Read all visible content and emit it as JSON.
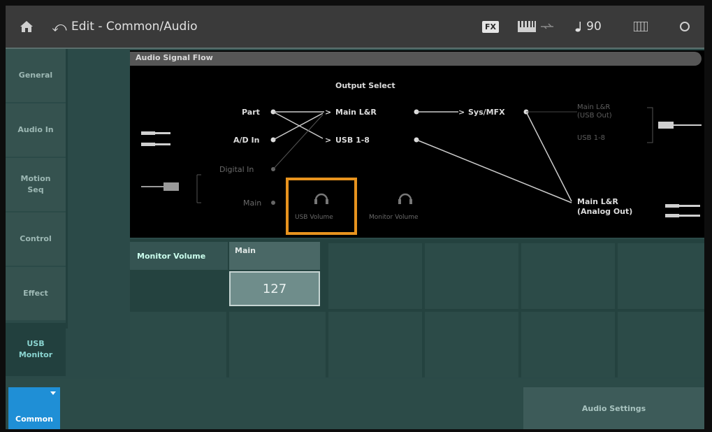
{
  "header": {
    "title": "Edit - Common/Audio",
    "fx_label": "FX",
    "tempo": "90",
    "tempo_icon": "quarter-note-icon"
  },
  "sidebar": {
    "items": [
      {
        "label": "General"
      },
      {
        "label": "Audio In"
      },
      {
        "label": "Motion\nSeq"
      },
      {
        "label": "Control"
      },
      {
        "label": "Effect"
      },
      {
        "label": "USB\nMonitor"
      }
    ]
  },
  "flow": {
    "title": "Audio Signal Flow",
    "output_select": "Output Select",
    "part": "Part",
    "ad_in": "A/D In",
    "digital_in": "Digital In",
    "main": "Main",
    "main_lr": "Main L&R",
    "usb_1_8": "USB 1-8",
    "sys_mfx": "Sys/MFX",
    "usb_volume": "USB Volume",
    "monitor_volume": "Monitor Volume",
    "out_main_lr_usb": "Main L&R\n(USB Out)",
    "out_usb_1_8": "USB 1-8",
    "out_main_lr_analog": "Main L&R\n(Analog Out)"
  },
  "params": {
    "monitor_volume_label": "Monitor Volume",
    "main_tab": "Main",
    "main_value": "127"
  },
  "bottom": {
    "common": "Common",
    "audio_settings": "Audio Settings"
  },
  "colors": {
    "accent": "#1f8fd6",
    "highlight": "#e8931e",
    "background": "#2b4a48"
  }
}
